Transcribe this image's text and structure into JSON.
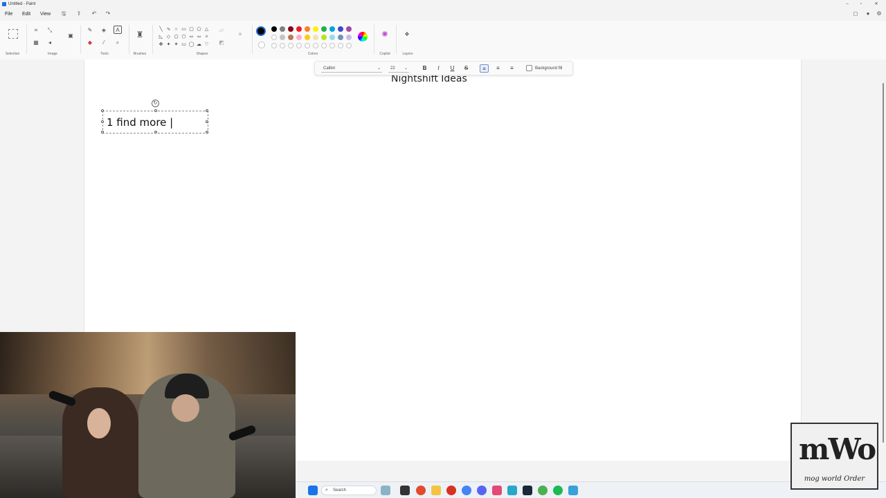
{
  "window": {
    "title": "Untitled - Paint",
    "minimize": "–",
    "maximize": "▫",
    "close": "✕"
  },
  "menu": {
    "file": "File",
    "edit": "Edit",
    "view": "View"
  },
  "ribbon": {
    "groups": {
      "selection": "Selection",
      "image": "Image",
      "tools": "Tools",
      "brushes": "Brushes",
      "shapes": "Shapes",
      "colors": "Colors",
      "copilot": "Copilot",
      "layers": "Layers"
    },
    "palette_row1": [
      "#000000",
      "#7f7f7f",
      "#880015",
      "#ed1c24",
      "#ff7f27",
      "#fff200",
      "#22b14c",
      "#00a2e8",
      "#3f48cc",
      "#a349a4"
    ],
    "palette_row2": [
      "#ffffff",
      "#c3c3c3",
      "#b97a57",
      "#ffaec9",
      "#ffc90e",
      "#efe4b0",
      "#b5e61d",
      "#99d9ea",
      "#7092be",
      "#c8bfe7"
    ],
    "active_color": "#000000"
  },
  "text_toolbar": {
    "font": "Calibri",
    "size": "22",
    "bold": "B",
    "italic": "I",
    "underline": "U",
    "strike": "S",
    "background_fill": "Background fill"
  },
  "canvas": {
    "title_text": "Nightshift Ideas",
    "textbox_text": "1 find more |"
  },
  "taskbar": {
    "search": "Search"
  },
  "overlay": {
    "logo_mark": "mWo",
    "logo_caption": "mog world Order"
  }
}
